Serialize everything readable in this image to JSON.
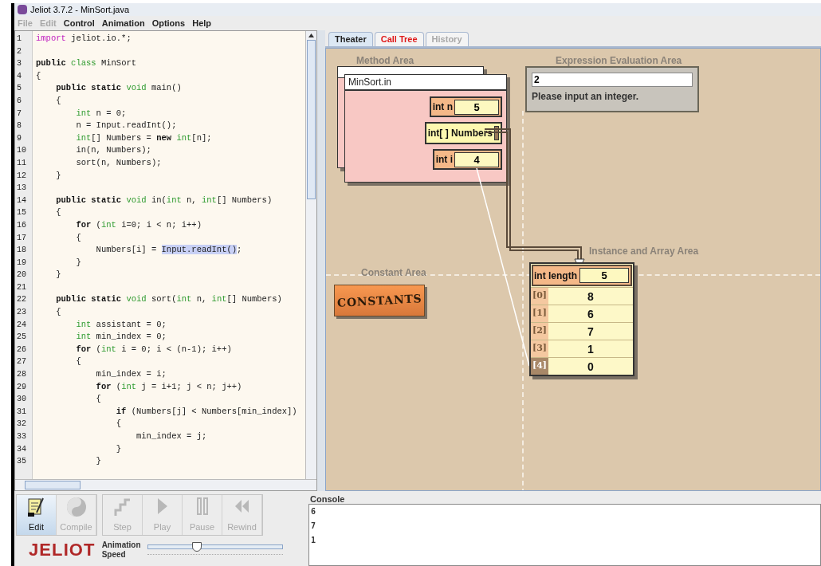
{
  "window": {
    "title": "Jeliot 3.7.2 - MinSort.java"
  },
  "menu": [
    {
      "label": "File",
      "disabled": true
    },
    {
      "label": "Edit",
      "disabled": true
    },
    {
      "label": "Control",
      "disabled": false
    },
    {
      "label": "Animation",
      "disabled": false
    },
    {
      "label": "Options",
      "disabled": false
    },
    {
      "label": "Help",
      "disabled": false
    }
  ],
  "code": [
    {
      "n": "1",
      "segs": [
        {
          "kind": "import",
          "t": "import"
        },
        {
          "kind": "plain",
          "t": " jeliot.io.*;"
        }
      ]
    },
    {
      "n": "2"
    },
    {
      "n": "3",
      "segs": [
        {
          "kind": "kw",
          "t": "public"
        },
        {
          "kind": "type",
          "t": " class"
        },
        {
          "kind": "plain",
          "t": " MinSort"
        }
      ]
    },
    {
      "n": "4",
      "segs": [
        {
          "kind": "plain",
          "t": "{"
        }
      ]
    },
    {
      "n": "5",
      "segs": [
        {
          "kind": "kw",
          "t": "    public static"
        },
        {
          "kind": "type",
          "t": " void"
        },
        {
          "kind": "plain",
          "t": " main()"
        }
      ]
    },
    {
      "n": "6",
      "segs": [
        {
          "kind": "plain",
          "t": "    {"
        }
      ]
    },
    {
      "n": "7",
      "segs": [
        {
          "kind": "type",
          "t": "        int"
        },
        {
          "kind": "plain",
          "t": " n = 0;"
        }
      ]
    },
    {
      "n": "8",
      "segs": [
        {
          "kind": "plain",
          "t": "        n = Input.readInt();"
        }
      ]
    },
    {
      "n": "9",
      "segs": [
        {
          "kind": "type",
          "t": "        int"
        },
        {
          "kind": "plain",
          "t": "[] Numbers = "
        },
        {
          "kind": "kw",
          "t": "new"
        },
        {
          "kind": "type",
          "t": " int"
        },
        {
          "kind": "plain",
          "t": "[n];"
        }
      ]
    },
    {
      "n": "10",
      "segs": [
        {
          "kind": "plain",
          "t": "        in(n, Numbers);"
        }
      ]
    },
    {
      "n": "11",
      "segs": [
        {
          "kind": "plain",
          "t": "        sort(n, Numbers);"
        }
      ]
    },
    {
      "n": "12",
      "segs": [
        {
          "kind": "plain",
          "t": "    }"
        }
      ]
    },
    {
      "n": "13"
    },
    {
      "n": "14",
      "segs": [
        {
          "kind": "kw",
          "t": "    public static"
        },
        {
          "kind": "type",
          "t": " void"
        },
        {
          "kind": "plain",
          "t": " in("
        },
        {
          "kind": "type",
          "t": "int"
        },
        {
          "kind": "plain",
          "t": " n, "
        },
        {
          "kind": "type",
          "t": "int"
        },
        {
          "kind": "plain",
          "t": "[] Numbers)"
        }
      ]
    },
    {
      "n": "15",
      "segs": [
        {
          "kind": "plain",
          "t": "    {"
        }
      ]
    },
    {
      "n": "16",
      "segs": [
        {
          "kind": "kw",
          "t": "        for"
        },
        {
          "kind": "plain",
          "t": " ("
        },
        {
          "kind": "type",
          "t": "int"
        },
        {
          "kind": "plain",
          "t": " i=0; i < n; i++)"
        }
      ]
    },
    {
      "n": "17",
      "segs": [
        {
          "kind": "plain",
          "t": "        {"
        }
      ]
    },
    {
      "n": "18",
      "segs": [
        {
          "kind": "plain",
          "t": "            Numbers[i] = "
        },
        {
          "kind": "highlight",
          "t": "Input.readInt()"
        },
        {
          "kind": "plain",
          "t": ";"
        }
      ]
    },
    {
      "n": "19",
      "segs": [
        {
          "kind": "plain",
          "t": "        }"
        }
      ]
    },
    {
      "n": "20",
      "segs": [
        {
          "kind": "plain",
          "t": "    }"
        }
      ]
    },
    {
      "n": "21"
    },
    {
      "n": "22",
      "segs": [
        {
          "kind": "kw",
          "t": "    public static"
        },
        {
          "kind": "type",
          "t": " void"
        },
        {
          "kind": "plain",
          "t": " sort("
        },
        {
          "kind": "type",
          "t": "int"
        },
        {
          "kind": "plain",
          "t": " n, "
        },
        {
          "kind": "type",
          "t": "int"
        },
        {
          "kind": "plain",
          "t": "[] Numbers)"
        }
      ]
    },
    {
      "n": "23",
      "segs": [
        {
          "kind": "plain",
          "t": "    {"
        }
      ]
    },
    {
      "n": "24",
      "segs": [
        {
          "kind": "type",
          "t": "        int"
        },
        {
          "kind": "plain",
          "t": " assistant = 0;"
        }
      ]
    },
    {
      "n": "25",
      "segs": [
        {
          "kind": "type",
          "t": "        int"
        },
        {
          "kind": "plain",
          "t": " min_index = 0;"
        }
      ]
    },
    {
      "n": "26",
      "segs": [
        {
          "kind": "kw",
          "t": "        for"
        },
        {
          "kind": "plain",
          "t": " ("
        },
        {
          "kind": "type",
          "t": "int"
        },
        {
          "kind": "plain",
          "t": " i = 0; i < (n-1); i++)"
        }
      ]
    },
    {
      "n": "27",
      "segs": [
        {
          "kind": "plain",
          "t": "        {"
        }
      ]
    },
    {
      "n": "28",
      "segs": [
        {
          "kind": "plain",
          "t": "            min_index = i;"
        }
      ]
    },
    {
      "n": "29",
      "segs": [
        {
          "kind": "kw",
          "t": "            for"
        },
        {
          "kind": "plain",
          "t": " ("
        },
        {
          "kind": "type",
          "t": "int"
        },
        {
          "kind": "plain",
          "t": " j = i+1; j < n; j++)"
        }
      ]
    },
    {
      "n": "30",
      "segs": [
        {
          "kind": "plain",
          "t": "            {"
        }
      ]
    },
    {
      "n": "31",
      "segs": [
        {
          "kind": "kw",
          "t": "                if"
        },
        {
          "kind": "plain",
          "t": " (Numbers[j] < Numbers[min_index])"
        }
      ]
    },
    {
      "n": "32",
      "segs": [
        {
          "kind": "plain",
          "t": "                {"
        }
      ]
    },
    {
      "n": "33",
      "segs": [
        {
          "kind": "plain",
          "t": "                    min_index = j;"
        }
      ]
    },
    {
      "n": "34",
      "segs": [
        {
          "kind": "plain",
          "t": "                }"
        }
      ]
    },
    {
      "n": "35",
      "segs": [
        {
          "kind": "plain",
          "t": "            }"
        }
      ]
    }
  ],
  "tabs": [
    {
      "label": "Theater",
      "selected": true,
      "kind": "normal"
    },
    {
      "label": "Call Tree",
      "selected": false,
      "kind": "alert"
    },
    {
      "label": "History",
      "selected": false,
      "kind": "disabled"
    }
  ],
  "theater": {
    "method_area": {
      "label": "Method Area",
      "frame": {
        "title": "MinSort.in",
        "vars": [
          {
            "kind": "value",
            "name": "int n",
            "value": "5"
          },
          {
            "kind": "reference",
            "name": "int[ ] Numbers"
          },
          {
            "kind": "value",
            "name": "int i",
            "value": "4"
          }
        ]
      }
    },
    "expression_area": {
      "label": "Expression Evaluation Area",
      "value": "2",
      "message": "Please input an integer."
    },
    "constant_area": {
      "label": "Constant Area",
      "badge": "CONSTANTS"
    },
    "instance_area": {
      "label": "Instance and Array Area",
      "length_label": "int length",
      "length": "5",
      "items": [
        {
          "index": "[0]",
          "value": "8",
          "selected": false
        },
        {
          "index": "[1]",
          "value": "6",
          "selected": false
        },
        {
          "index": "[2]",
          "value": "7",
          "selected": false
        },
        {
          "index": "[3]",
          "value": "1",
          "selected": false
        },
        {
          "index": "[4]",
          "value": "0",
          "selected": true
        }
      ]
    }
  },
  "toolbar": [
    {
      "label": "Edit",
      "disabled": false,
      "selected": true
    },
    {
      "label": "Compile",
      "disabled": true,
      "selected": false
    },
    {
      "label": "Step",
      "disabled": true,
      "selected": false
    },
    {
      "label": "Play",
      "disabled": true,
      "selected": false
    },
    {
      "label": "Pause",
      "disabled": true,
      "selected": false
    },
    {
      "label": "Rewind",
      "disabled": true,
      "selected": false
    }
  ],
  "logo": "JELIOT",
  "speed": {
    "label_1": "Animation",
    "label_2": "Speed",
    "level": 0.37
  },
  "console": {
    "title": "Console",
    "lines": [
      "6",
      "7",
      "1"
    ]
  }
}
